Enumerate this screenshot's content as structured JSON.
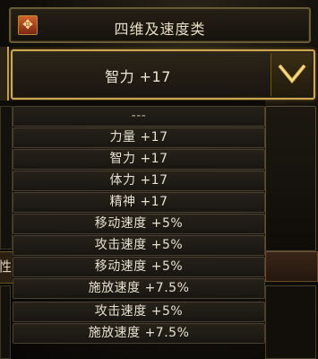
{
  "title": {
    "text": "四维及速度类",
    "icon": "emblem-icon",
    "icon_glyph": "✥"
  },
  "dropdown": {
    "selected": "智力 +17",
    "arrow_icon": "chevron-down-icon"
  },
  "options": [
    "---",
    "力量 +17",
    "智力 +17",
    "体力 +17",
    "精神 +17",
    "移动速度 +5%",
    "攻击速度 +5%",
    "移动速度 +5%",
    "施放速度 +7.5%",
    "攻击速度 +5%",
    "施放速度 +7.5%"
  ],
  "background": {
    "left_partial_text": "性"
  },
  "colors": {
    "accent_gold": "#cda54c",
    "text": "#e6e0cf"
  }
}
